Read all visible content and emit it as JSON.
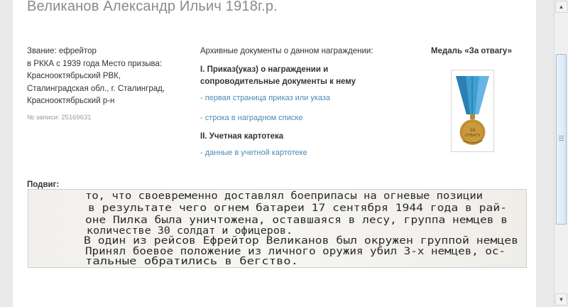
{
  "header": {
    "title": "Великанов Александр Ильич 1918г.р."
  },
  "person": {
    "lines": [
      "Звание: ефрейтор",
      "в РККА с 1939 года Место призыва:",
      "Краснооктябрьский РВК,",
      "Сталинградская обл., г. Сталинград,",
      "Краснооктябрьский р-н"
    ],
    "record_no": "№ записи: 25169631"
  },
  "archive": {
    "heading": "Архивные документы о данном награждении:",
    "section1": "I. Приказ(указ) о награждении и сопроводительные документы к нему",
    "link1": "- первая страница приказ или указа",
    "link2": "- строка в наградном списке",
    "section2": "II. Учетная картотека",
    "link3": "- данные в учетной картотеке"
  },
  "medal": {
    "title": "Медаль «За отвагу»",
    "text1": "ЗА",
    "text2": "ОТВАГУ",
    "ribbon_color": "#3f9fd3",
    "medal_color": "#c99a3c"
  },
  "feat": {
    "label": "Подвиг:",
    "lines": [
      "то, что своевременно доставлял боеприпасы на огневые позиции",
      "в результате чего огнем батареи 17 сентября 1944 года в рай-",
      "оне Пилка была уничтожена, оставшаяся в лесу, группа немцев в",
      "количестве 30 солдат и офицеров.",
      "В один из рейсов Ефрейтор Великанов был окружен группой немцев",
      "Принял боевое положение из личного оружия убил 3-х немцев, ос-",
      "тальные обратились в бегство."
    ]
  }
}
